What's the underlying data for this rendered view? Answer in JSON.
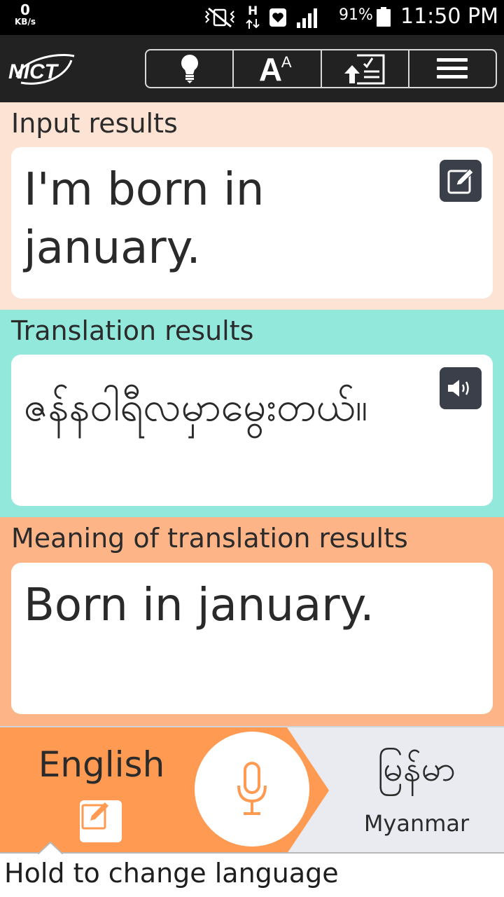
{
  "status_bar": {
    "net_speed_value": "0",
    "net_speed_unit": "KB/s",
    "network_type": "H",
    "battery": "91%",
    "time": "11:50 PM"
  },
  "app_bar": {
    "logo_text": "NICT",
    "tools": [
      {
        "icon": "lightbulb-icon"
      },
      {
        "icon": "font-size-icon",
        "label_big": "A",
        "label_small": "A"
      },
      {
        "icon": "upload-checklist-icon"
      },
      {
        "icon": "menu-icon"
      }
    ]
  },
  "input": {
    "title": "Input results",
    "text": "I'm born in january."
  },
  "translation": {
    "title": "Translation results",
    "text": "ဇန်နဝါရီလမှာမွေးတယ်။"
  },
  "meaning": {
    "title": "Meaning of translation results",
    "text": "Born in january."
  },
  "language_bar": {
    "source_language": "English",
    "target_language_native": "မြန်မာ",
    "target_language": "Myanmar"
  },
  "hint": {
    "text": "Hold to change language"
  },
  "colors": {
    "input_bg": "#fde3d4",
    "translation_bg": "#93e8dc",
    "meaning_bg": "#fdb588",
    "accent_orange": "#ff9a52",
    "app_bar": "#222222"
  }
}
